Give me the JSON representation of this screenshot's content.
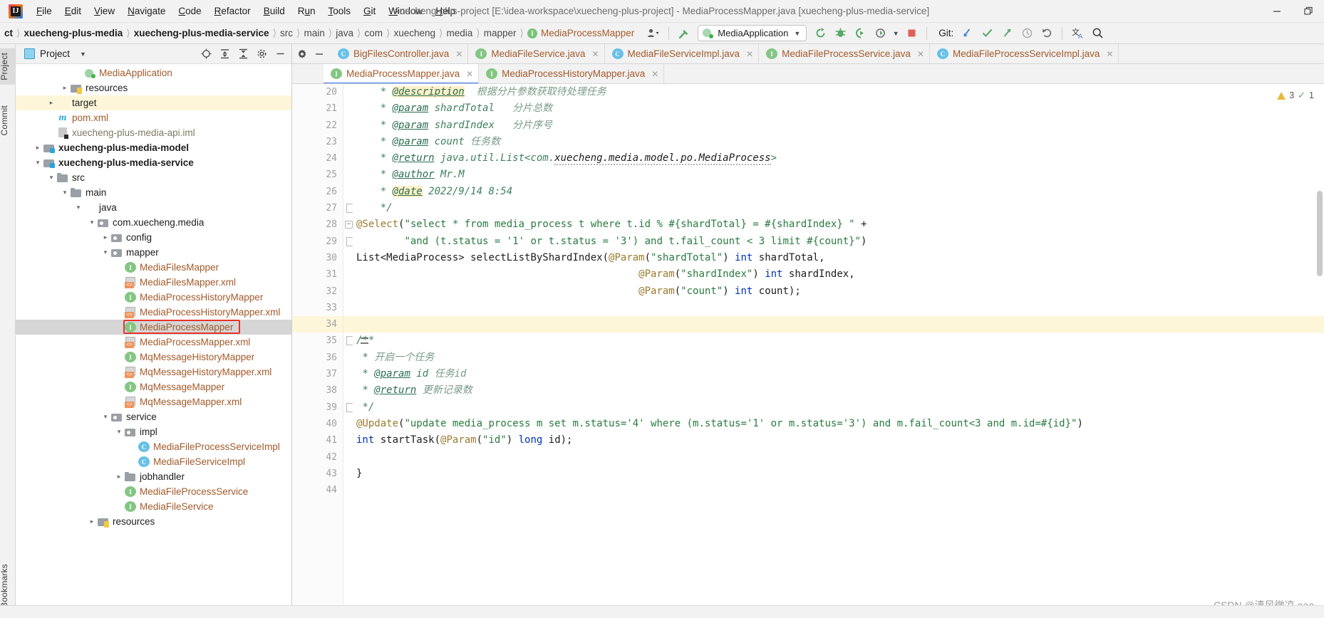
{
  "window": {
    "title": "xuecheng-plus-project [E:\\idea-workspace\\xuecheng-plus-project] - MediaProcessMapper.java [xuecheng-plus-media-service]",
    "minimize_label": "—",
    "restore_label": "❐"
  },
  "menubar": {
    "items": [
      {
        "mnemonic": "F",
        "rest": "ile"
      },
      {
        "mnemonic": "E",
        "rest": "dit"
      },
      {
        "mnemonic": "V",
        "rest": "iew"
      },
      {
        "mnemonic": "N",
        "rest": "avigate"
      },
      {
        "mnemonic": "C",
        "rest": "ode"
      },
      {
        "mnemonic": "R",
        "rest": "efactor"
      },
      {
        "mnemonic": "B",
        "rest": "uild"
      },
      {
        "mnemonic": "R",
        "rest": "un",
        "pre": "R"
      },
      {
        "mnemonic": "T",
        "rest": "ools"
      },
      {
        "mnemonic": "G",
        "rest": "it"
      },
      {
        "mnemonic": "W",
        "rest": "indow"
      },
      {
        "mnemonic": "H",
        "rest": "elp"
      }
    ]
  },
  "breadcrumb": {
    "items": [
      {
        "label": "ct",
        "style": "bold"
      },
      {
        "label": "xuecheng-plus-media",
        "style": "bold"
      },
      {
        "label": "xuecheng-plus-media-service",
        "style": "bold"
      },
      {
        "label": "src",
        "style": "normal"
      },
      {
        "label": "main",
        "style": "normal"
      },
      {
        "label": "java",
        "style": "normal"
      },
      {
        "label": "com",
        "style": "normal"
      },
      {
        "label": "xuecheng",
        "style": "normal"
      },
      {
        "label": "media",
        "style": "normal"
      },
      {
        "label": "mapper",
        "style": "normal"
      },
      {
        "label": "MediaProcessMapper",
        "style": "file",
        "badge": "I"
      }
    ],
    "separator": "〉"
  },
  "toolbar": {
    "run_config": "MediaApplication",
    "git_label": "Git:",
    "icons": [
      "avatar-icon",
      "hammer-build-icon",
      "rerun-icon",
      "debug-icon",
      "run-with-coverage-icon",
      "profiler-icon",
      "stop-icon",
      "git-update-icon",
      "git-commit-icon",
      "git-push-icon",
      "history-icon",
      "rollback-icon",
      "translate-icon",
      "search-everywhere-icon"
    ]
  },
  "left_strip": {
    "tabs": [
      "Project",
      "Commit",
      "Bookmarks"
    ]
  },
  "project_panel": {
    "title": "Project",
    "header_icons": [
      "locate-icon",
      "expand-all-icon",
      "collapse-all-icon",
      "settings-icon",
      "hide-icon"
    ],
    "tree": [
      {
        "indent": 4,
        "arrow": "",
        "icon": "springapp",
        "label": "MediaApplication",
        "color": "brown"
      },
      {
        "indent": 3,
        "arrow": "›",
        "icon": "res",
        "label": "resources",
        "color": "dark"
      },
      {
        "indent": 2,
        "arrow": "›",
        "icon": "folder-orange",
        "label": "target",
        "color": "dark",
        "highlight": "yellow"
      },
      {
        "indent": 2,
        "arrow": "",
        "icon": "maven",
        "label": "pom.xml",
        "color": "brown"
      },
      {
        "indent": 2,
        "arrow": "",
        "icon": "iml",
        "label": "xuecheng-plus-media-api.iml",
        "color": "grey"
      },
      {
        "indent": 1,
        "arrow": "›",
        "icon": "module",
        "label": "xuecheng-plus-media-model",
        "color": "dark",
        "bold": true
      },
      {
        "indent": 1,
        "arrow": "⌄",
        "icon": "module",
        "label": "xuecheng-plus-media-service",
        "color": "dark",
        "bold": true
      },
      {
        "indent": 2,
        "arrow": "⌄",
        "icon": "folder",
        "label": "src",
        "color": "dark"
      },
      {
        "indent": 3,
        "arrow": "⌄",
        "icon": "folder",
        "label": "main",
        "color": "dark"
      },
      {
        "indent": 4,
        "arrow": "⌄",
        "icon": "folder-blue",
        "label": "java",
        "color": "dark"
      },
      {
        "indent": 5,
        "arrow": "⌄",
        "icon": "pkg",
        "label": "com.xuecheng.media",
        "color": "dark"
      },
      {
        "indent": 6,
        "arrow": "›",
        "icon": "pkg",
        "label": "config",
        "color": "dark"
      },
      {
        "indent": 6,
        "arrow": "⌄",
        "icon": "pkg",
        "label": "mapper",
        "color": "dark"
      },
      {
        "indent": 7,
        "arrow": "",
        "icon": "iface",
        "label": "MediaFilesMapper",
        "color": "brown"
      },
      {
        "indent": 7,
        "arrow": "",
        "icon": "xml",
        "label": "MediaFilesMapper.xml",
        "color": "brown"
      },
      {
        "indent": 7,
        "arrow": "",
        "icon": "iface",
        "label": "MediaProcessHistoryMapper",
        "color": "brown"
      },
      {
        "indent": 7,
        "arrow": "",
        "icon": "xml",
        "label": "MediaProcessHistoryMapper.xml",
        "color": "brown"
      },
      {
        "indent": 7,
        "arrow": "",
        "icon": "iface",
        "label": "MediaProcessMapper",
        "color": "brown",
        "highlight": "grey",
        "selected_box": true
      },
      {
        "indent": 7,
        "arrow": "",
        "icon": "xml",
        "label": "MediaProcessMapper.xml",
        "color": "brown"
      },
      {
        "indent": 7,
        "arrow": "",
        "icon": "iface",
        "label": "MqMessageHistoryMapper",
        "color": "brown"
      },
      {
        "indent": 7,
        "arrow": "",
        "icon": "xml",
        "label": "MqMessageHistoryMapper.xml",
        "color": "brown"
      },
      {
        "indent": 7,
        "arrow": "",
        "icon": "iface",
        "label": "MqMessageMapper",
        "color": "brown"
      },
      {
        "indent": 7,
        "arrow": "",
        "icon": "xml",
        "label": "MqMessageMapper.xml",
        "color": "brown"
      },
      {
        "indent": 6,
        "arrow": "⌄",
        "icon": "pkg",
        "label": "service",
        "color": "dark"
      },
      {
        "indent": 7,
        "arrow": "⌄",
        "icon": "pkg",
        "label": "impl",
        "color": "dark"
      },
      {
        "indent": 8,
        "arrow": "",
        "icon": "cls",
        "label": "MediaFileProcessServiceImpl",
        "color": "brown"
      },
      {
        "indent": 8,
        "arrow": "",
        "icon": "cls",
        "label": "MediaFileServiceImpl",
        "color": "brown"
      },
      {
        "indent": 7,
        "arrow": "›",
        "icon": "folder",
        "label": "jobhandler",
        "color": "dark"
      },
      {
        "indent": 7,
        "arrow": "",
        "icon": "iface",
        "label": "MediaFileProcessService",
        "color": "brown"
      },
      {
        "indent": 7,
        "arrow": "",
        "icon": "iface",
        "label": "MediaFileService",
        "color": "brown"
      },
      {
        "indent": 5,
        "arrow": "›",
        "icon": "res",
        "label": "resources",
        "color": "dark"
      }
    ]
  },
  "editor": {
    "tabs_row1": [
      {
        "label": "BigFilesController.java",
        "kind": "C",
        "active": false
      },
      {
        "label": "MediaFileService.java",
        "kind": "I",
        "active": false
      },
      {
        "label": "MediaFileServiceImpl.java",
        "kind": "C",
        "active": false
      },
      {
        "label": "MediaFileProcessService.java",
        "kind": "I",
        "active": false
      },
      {
        "label": "MediaFileProcessServiceImpl.java",
        "kind": "C",
        "active": false
      }
    ],
    "tabs_row2": [
      {
        "label": "MediaProcessMapper.java",
        "kind": "I",
        "active": true
      },
      {
        "label": "MediaProcessHistoryMapper.java",
        "kind": "I",
        "active": false
      }
    ],
    "inspection": {
      "warnings": "3",
      "ok_count": "1"
    },
    "watermark": "CSDN @清风微凉 aaa",
    "first_line_number": 20,
    "lines": [
      {
        "n": 20,
        "fold": "",
        "hl": false,
        "html": "    <span class=\"k-javadoc\">* </span><span class=\"k-tag-hl\">@description</span><span class=\"k-cn\">  根据分片参数获取待处理任务</span>"
      },
      {
        "n": 21,
        "fold": "",
        "hl": false,
        "html": "    <span class=\"k-javadoc\">* </span><span class=\"k-tag\">@param</span><span class=\"k-javadoc\"> shardTotal</span><span class=\"k-cn\">   分片总数</span>"
      },
      {
        "n": 22,
        "fold": "",
        "hl": false,
        "html": "    <span class=\"k-javadoc\">* </span><span class=\"k-tag\">@param</span><span class=\"k-javadoc\"> shardIndex</span><span class=\"k-cn\">   分片序号</span>"
      },
      {
        "n": 23,
        "fold": "",
        "hl": false,
        "html": "    <span class=\"k-javadoc\">* </span><span class=\"k-tag\">@param</span><span class=\"k-javadoc\"> count</span><span class=\"k-cn\"> 任务数</span>"
      },
      {
        "n": 24,
        "fold": "",
        "hl": false,
        "html": "    <span class=\"k-javadoc\">* </span><span class=\"k-tag\">@return</span><span class=\"k-javadoc\"> java.util.List&lt;com.</span><span class=\"k-wave k-javadoc\">xuecheng.media.model.po.MediaProcess</span><span class=\"k-javadoc\">&gt;</span>"
      },
      {
        "n": 25,
        "fold": "",
        "hl": false,
        "html": "    <span class=\"k-javadoc\">* </span><span class=\"k-tag\">@author</span><span class=\"k-javadoc\"> Mr.M</span>"
      },
      {
        "n": 26,
        "fold": "",
        "hl": false,
        "html": "    <span class=\"k-javadoc\">* </span><span class=\"k-tag-hl\">@date</span><span class=\"k-javadoc\"> 2022/9/14 8:54</span>"
      },
      {
        "n": 27,
        "fold": "minus",
        "hl": false,
        "html": "    <span class=\"k-javadoc\">*/</span>"
      },
      {
        "n": 28,
        "fold": "arrow",
        "hl": false,
        "html": "<span class=\"k-anno\">@Select</span><span class=\"k-plain\">(</span><span class=\"k-string\">\"select * from media_process t where t.id % #{shardTotal} = #{shardIndex} \"</span><span class=\"k-plain\"> +</span>"
      },
      {
        "n": 29,
        "fold": "minus",
        "hl": false,
        "html": "        <span class=\"k-string\">\"and (t.status = '1' or t.status = '3') and t.fail_count &lt; 3 limit #{count}\"</span><span class=\"k-plain\">)</span>"
      },
      {
        "n": 30,
        "fold": "",
        "hl": false,
        "html": "<span class=\"k-type\">List&lt;MediaProcess&gt; </span><span class=\"k-method\">selectListByShardIndex</span><span class=\"k-plain\">(</span><span class=\"k-anno\">@Param</span><span class=\"k-plain\">(</span><span class=\"k-string\">\"shardTotal\"</span><span class=\"k-plain\">) </span><span class=\"k-kw\">int</span><span class=\"k-plain\"> shardTotal,</span>"
      },
      {
        "n": 31,
        "fold": "",
        "hl": false,
        "html": "                                               <span class=\"k-anno\">@Param</span><span class=\"k-plain\">(</span><span class=\"k-string\">\"shardIndex\"</span><span class=\"k-plain\">) </span><span class=\"k-kw\">int</span><span class=\"k-plain\"> shardIndex,</span>"
      },
      {
        "n": 32,
        "fold": "",
        "hl": false,
        "html": "                                               <span class=\"k-anno\">@Param</span><span class=\"k-plain\">(</span><span class=\"k-string\">\"count\"</span><span class=\"k-plain\">) </span><span class=\"k-kw\">int</span><span class=\"k-plain\"> count);</span>"
      },
      {
        "n": 33,
        "fold": "",
        "hl": false,
        "html": ""
      },
      {
        "n": 34,
        "fold": "",
        "hl": true,
        "html": ""
      },
      {
        "n": 35,
        "fold": "minus",
        "hl": false,
        "gutter_extra": "changes",
        "html": "<span class=\"k-javadoc\">/**</span>"
      },
      {
        "n": 36,
        "fold": "",
        "hl": false,
        "html": " <span class=\"k-javadoc\">* </span><span class=\"k-cn\">开启一个任务</span>"
      },
      {
        "n": 37,
        "fold": "",
        "hl": false,
        "html": " <span class=\"k-javadoc\">* </span><span class=\"k-tag\">@param</span><span class=\"k-javadoc\"> id </span><span class=\"k-cn\">任务id</span>"
      },
      {
        "n": 38,
        "fold": "",
        "hl": false,
        "html": " <span class=\"k-javadoc\">* </span><span class=\"k-tag\">@return</span><span class=\"k-cn\"> 更新记录数</span>"
      },
      {
        "n": 39,
        "fold": "minus",
        "hl": false,
        "html": " <span class=\"k-javadoc\">*/</span>"
      },
      {
        "n": 40,
        "fold": "",
        "hl": false,
        "html": "<span class=\"k-anno\">@Update</span><span class=\"k-plain\">(</span><span class=\"k-string\">\"update media_process m set m.status='4' where (m.status='1' or m.status='3') and m.fail_count&lt;3 and m.id=#{id}\"</span><span class=\"k-plain\">)</span>"
      },
      {
        "n": 41,
        "fold": "",
        "hl": false,
        "html": "<span class=\"k-kw\">int</span><span class=\"k-plain\"> </span><span class=\"k-method\">startTask</span><span class=\"k-plain\">(</span><span class=\"k-anno\">@Param</span><span class=\"k-plain\">(</span><span class=\"k-string\">\"id\"</span><span class=\"k-plain\">) </span><span class=\"k-kw\">long</span><span class=\"k-plain\"> id);</span>"
      },
      {
        "n": 42,
        "fold": "",
        "hl": false,
        "html": ""
      },
      {
        "n": 43,
        "fold": "",
        "hl": false,
        "html": "<span class=\"k-plain\">}</span>"
      },
      {
        "n": 44,
        "fold": "",
        "hl": false,
        "html": ""
      }
    ]
  }
}
